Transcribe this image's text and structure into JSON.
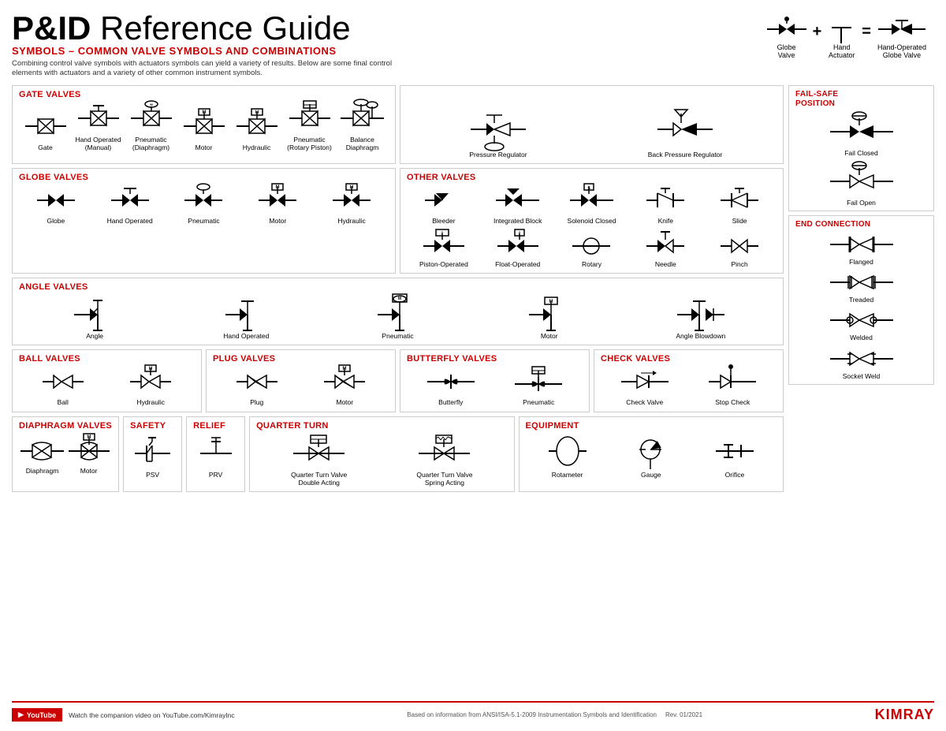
{
  "header": {
    "title_bold": "P&ID",
    "title_rest": " Reference Guide",
    "subtitle": "SYMBOLS – COMMON VALVE SYMBOLS AND COMBINATIONS",
    "description": "Combining control valve symbols with actuators symbols can yield a variety of results. Below are some final control elements with actuators and a variety of other common instrument symbols."
  },
  "equation": {
    "items": [
      {
        "label": "Globe\nValve",
        "type": "globe"
      },
      {
        "op": "+"
      },
      {
        "label": "Hand\nActuator",
        "type": "hand"
      },
      {
        "op": "="
      },
      {
        "label": "Hand-Operated\nGlobe Valve",
        "type": "hand-globe"
      }
    ]
  },
  "sections": {
    "gate_valves": {
      "title": "GATE VALVES",
      "items": [
        {
          "label": "Gate",
          "type": "gate"
        },
        {
          "label": "Hand Operated\n(Manual)",
          "type": "hand-gate"
        },
        {
          "label": "Pneumatic\n(Diaphragm)",
          "type": "pneumatic-gate"
        },
        {
          "label": "Motor",
          "type": "motor-gate"
        },
        {
          "label": "Hydraulic",
          "type": "hydraulic-gate"
        },
        {
          "label": "Pneumatic\n(Rotary Piston)",
          "type": "rotary-piston-gate"
        },
        {
          "label": "Balance\nDiaphragm",
          "type": "balance-diaphragm"
        }
      ],
      "extra": [
        {
          "label": "Pressure Regulator",
          "type": "pressure-reg"
        },
        {
          "label": "Back Pressure Regulator",
          "type": "back-pressure-reg"
        }
      ]
    },
    "globe_valves": {
      "title": "GLOBE VALVES",
      "items": [
        {
          "label": "Globe",
          "type": "globe"
        },
        {
          "label": "Hand Operated",
          "type": "hand-globe"
        },
        {
          "label": "Pneumatic",
          "type": "pneumatic-globe"
        },
        {
          "label": "Motor",
          "type": "motor-globe"
        },
        {
          "label": "Hydraulic",
          "type": "hydraulic-globe"
        }
      ]
    },
    "other_valves": {
      "title": "OTHER VALVES",
      "items": [
        {
          "label": "Bleeder",
          "type": "bleeder"
        },
        {
          "label": "Integrated Block",
          "type": "integrated-block"
        },
        {
          "label": "Solenoid Closed",
          "type": "solenoid-closed"
        },
        {
          "label": "Knife",
          "type": "knife"
        },
        {
          "label": "Slide",
          "type": "slide"
        }
      ],
      "items2": [
        {
          "label": "Piston-Operated",
          "type": "piston-operated"
        },
        {
          "label": "Float-Operated",
          "type": "float-operated"
        },
        {
          "label": "Rotary",
          "type": "rotary"
        },
        {
          "label": "Needle",
          "type": "needle"
        },
        {
          "label": "Pinch",
          "type": "pinch"
        }
      ]
    },
    "angle_valves": {
      "title": "ANGLE VALVES",
      "items": [
        {
          "label": "Angle",
          "type": "angle"
        },
        {
          "label": "Hand Operated",
          "type": "hand-angle"
        },
        {
          "label": "Pneumatic",
          "type": "pneumatic-angle"
        },
        {
          "label": "Motor",
          "type": "motor-angle"
        },
        {
          "label": "Angle Blowdown",
          "type": "angle-blowdown"
        }
      ]
    },
    "ball_valves": {
      "title": "BALL VALVES",
      "items": [
        {
          "label": "Ball",
          "type": "ball"
        },
        {
          "label": "Hydraulic",
          "type": "hydraulic-ball"
        }
      ]
    },
    "plug_valves": {
      "title": "PLUG VALVES",
      "items": [
        {
          "label": "Plug",
          "type": "plug"
        },
        {
          "label": "Motor",
          "type": "motor-plug"
        }
      ]
    },
    "butterfly_valves": {
      "title": "BUTTERFLY VALVES",
      "items": [
        {
          "label": "Butterfly",
          "type": "butterfly"
        },
        {
          "label": "Pneumatic",
          "type": "pneumatic-butterfly"
        }
      ]
    },
    "check_valves": {
      "title": "CHECK VALVES",
      "items": [
        {
          "label": "Check Valve",
          "type": "check-valve"
        },
        {
          "label": "Stop Check",
          "type": "stop-check"
        }
      ]
    },
    "diaphragm_valves": {
      "title": "DIAPHRAGM VALVES",
      "items": [
        {
          "label": "Diaphragm",
          "type": "diaphragm"
        },
        {
          "label": "Motor",
          "type": "motor-diaphragm"
        }
      ]
    },
    "safety": {
      "title": "SAFETY",
      "items": [
        {
          "label": "PSV",
          "type": "psv"
        }
      ]
    },
    "relief": {
      "title": "RELIEF",
      "items": [
        {
          "label": "PRV",
          "type": "prv"
        }
      ]
    },
    "quarter_turn": {
      "title": "QUARTER TURN",
      "items": [
        {
          "label": "Quarter Turn Valve\nDouble Acting",
          "type": "qt-double"
        },
        {
          "label": "Quarter Turn Valve\nSpring Acting",
          "type": "qt-spring"
        }
      ]
    },
    "equipment": {
      "title": "EQUIPMENT",
      "items": [
        {
          "label": "Rotameter",
          "type": "rotameter"
        },
        {
          "label": "Gauge",
          "type": "gauge"
        },
        {
          "label": "Orifice",
          "type": "orifice"
        }
      ]
    }
  },
  "fail_safe": {
    "title": "FAIL-SAFE\nPOSITION",
    "items": [
      {
        "label": "Fail Closed",
        "type": "fail-closed"
      },
      {
        "label": "Fail Open",
        "type": "fail-open"
      }
    ]
  },
  "end_connection": {
    "title": "END CONNECTION",
    "items": [
      {
        "label": "Flanged",
        "type": "flanged"
      },
      {
        "label": "Treaded",
        "type": "treaded"
      },
      {
        "label": "Welded",
        "type": "welded"
      },
      {
        "label": "Socket Weld",
        "type": "socket-weld"
      }
    ]
  },
  "footer": {
    "youtube_label": "YouTube",
    "youtube_text": "Watch the companion video on YouTube.com/KimrayInc",
    "based_on": "Based on information from ANSI/ISA-5.1-2009 Instrumentation Symbols and Identification",
    "rev": "Rev. 01/2021",
    "logo": "KIMRAY"
  }
}
